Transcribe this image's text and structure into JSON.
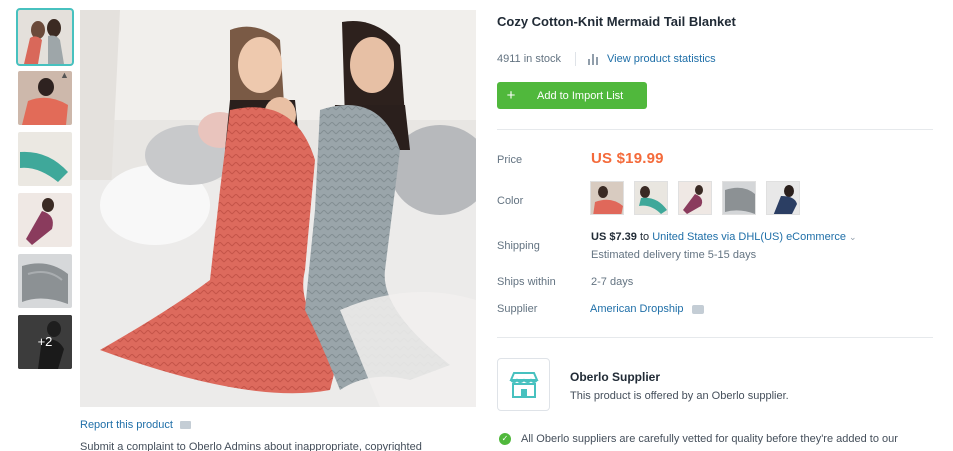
{
  "thumbnails": [
    {
      "name": "thumb-1",
      "bg": "#d9d4cf",
      "tail": "#d9685a"
    },
    {
      "name": "thumb-2",
      "bg": "#cbb7ab",
      "tail": "#e26b58"
    },
    {
      "name": "thumb-3",
      "bg": "#e9e6e0",
      "tail": "#3fa89a"
    },
    {
      "name": "thumb-4",
      "bg": "#ede6e2",
      "tail": "#8a3b5d"
    },
    {
      "name": "thumb-5",
      "bg": "#cfd1d3",
      "tail": "#8c9194"
    }
  ],
  "more_thumbs_label": "+2",
  "report": {
    "link": "Report this product",
    "description": "Submit a complaint to Oberlo Admins about inappropriate, copyrighted"
  },
  "product": {
    "title": "Cozy Cotton-Knit Mermaid Tail Blanket",
    "stock": "4911 in stock",
    "stats_link": "View product statistics",
    "import_button": "Add to Import List",
    "import_plus": "+"
  },
  "labels": {
    "price": "Price",
    "color": "Color",
    "shipping": "Shipping",
    "ships_within": "Ships within",
    "supplier": "Supplier"
  },
  "price": "US $19.99",
  "colors": [
    {
      "name": "coral",
      "tail": "#e0685a",
      "bg": "#d8cbc0"
    },
    {
      "name": "teal",
      "tail": "#3fa89a",
      "bg": "#e9e6e0"
    },
    {
      "name": "burgundy",
      "tail": "#8a3b5d",
      "bg": "#efe8e4"
    },
    {
      "name": "grey",
      "tail": "#8c9194",
      "bg": "#d4d6d8"
    },
    {
      "name": "navy",
      "tail": "#2b3e63",
      "bg": "#e8e8e8"
    }
  ],
  "shipping": {
    "cost": "US $7.39",
    "to_word": "to",
    "destination": "United States via DHL(US) eCommerce",
    "chevron": "⌄",
    "delivery": "Estimated delivery time 5-15 days"
  },
  "ships_within": "2-7 days",
  "supplier_name": "American Dropship",
  "oberlo": {
    "title": "Oberlo Supplier",
    "subtitle": "This product is offered by an Oberlo supplier."
  },
  "vetted_text": "All Oberlo suppliers are carefully vetted for quality before they're added to our",
  "accent_colors": {
    "link": "#1f6fa8",
    "button": "#50b83c",
    "price": "#f46a3a",
    "oberlo_icon": "#47c1bf"
  }
}
